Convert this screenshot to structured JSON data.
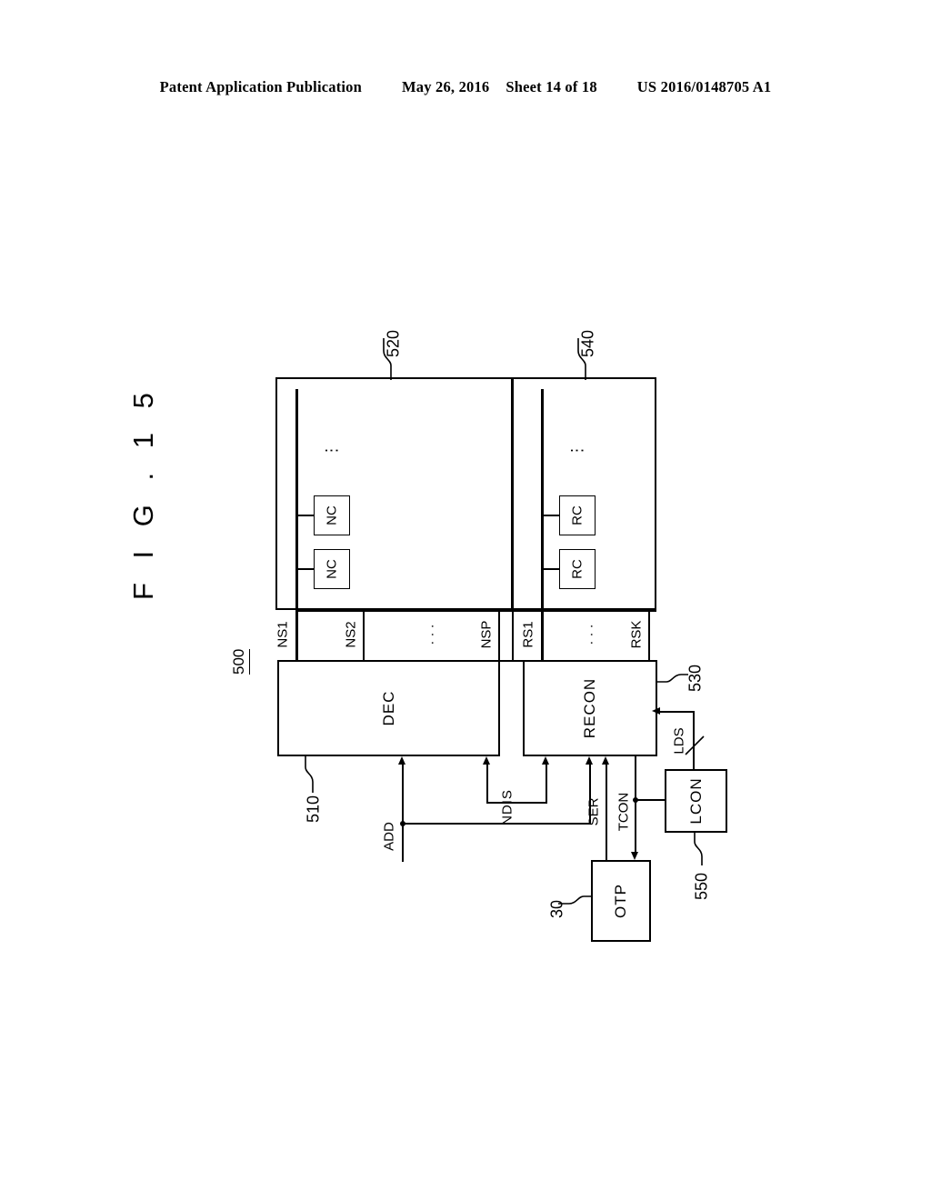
{
  "header": {
    "publication": "Patent Application Publication",
    "date": "May 26, 2016",
    "sheet": "Sheet 14 of 18",
    "docnum": "US 2016/0148705 A1"
  },
  "figure": {
    "title": "F I G .  1 5",
    "device_ref": "500"
  },
  "blocks": [
    {
      "id": "normal-cell-array",
      "label": "",
      "ref": "520"
    },
    {
      "id": "redundancy-cell-array",
      "label": "",
      "ref": "540"
    },
    {
      "id": "decoder",
      "label": "DEC",
      "ref": "510"
    },
    {
      "id": "reconfigurer",
      "label": "RECON",
      "ref": "530"
    },
    {
      "id": "link-controller",
      "label": "LCON",
      "ref": "550"
    },
    {
      "id": "otp-memory",
      "label": "OTP",
      "ref": "30"
    }
  ],
  "cells": {
    "normal": [
      "NC",
      "NC"
    ],
    "redundancy": [
      "RC",
      "RC"
    ],
    "vertical_ellipsis": "⋮"
  },
  "signals": {
    "normal_select": [
      "NS1",
      "NS2",
      "NSP"
    ],
    "normal_ellipsis": "· · ·",
    "redundancy_select": [
      "RS1",
      "RSK"
    ],
    "redundancy_ellipsis": "· · ·",
    "address": "ADD",
    "disable": "NDIS",
    "serial": "SER",
    "control": "TCON",
    "link_data": "LDS"
  },
  "refs": {
    "cell_array": "520",
    "redundancy_array": "540",
    "decoder": "510",
    "reconfigurer": "530",
    "link_controller": "550",
    "otp": "30",
    "device": "500"
  }
}
